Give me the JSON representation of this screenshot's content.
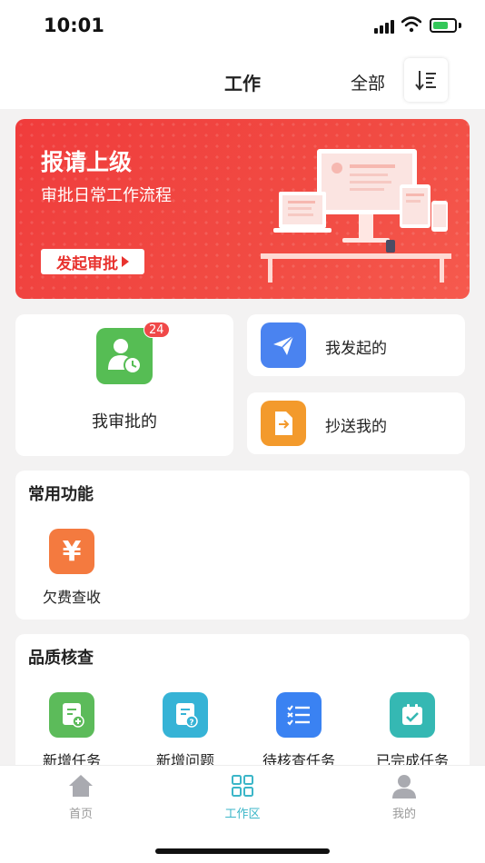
{
  "status_bar": {
    "time": "10:01"
  },
  "header": {
    "title": "工作",
    "filter_label": "全部"
  },
  "banner": {
    "title": "报请上级",
    "subtitle": "审批日常工作流程",
    "button_label": "发起审批"
  },
  "approvals": {
    "my_approvals": {
      "label": "我审批的",
      "badge": "24"
    },
    "initiated": {
      "label": "我发起的"
    },
    "cc_to_me": {
      "label": "抄送我的"
    }
  },
  "common_functions": {
    "title": "常用功能",
    "items": [
      {
        "label": "欠费查收",
        "icon": "yen-icon",
        "color": "#f47a3f"
      }
    ]
  },
  "quality_check": {
    "title": "品质核查",
    "items": [
      {
        "label": "新增任务",
        "icon": "add-doc-icon",
        "color": "#5cbb5a"
      },
      {
        "label": "新增问题",
        "icon": "question-doc-icon",
        "color": "#36b3d6"
      },
      {
        "label": "待核查任务",
        "icon": "checklist-icon",
        "color": "#3a82f2"
      },
      {
        "label": "已完成任务",
        "icon": "calendar-check-icon",
        "color": "#35b8b3"
      }
    ]
  },
  "tabbar": {
    "items": [
      {
        "label": "首页",
        "icon": "home-icon"
      },
      {
        "label": "工作区",
        "icon": "grid-icon"
      },
      {
        "label": "我的",
        "icon": "user-icon"
      }
    ]
  },
  "colors": {
    "accent": "#3bb6c8",
    "banner_red": "#f03c3c"
  }
}
